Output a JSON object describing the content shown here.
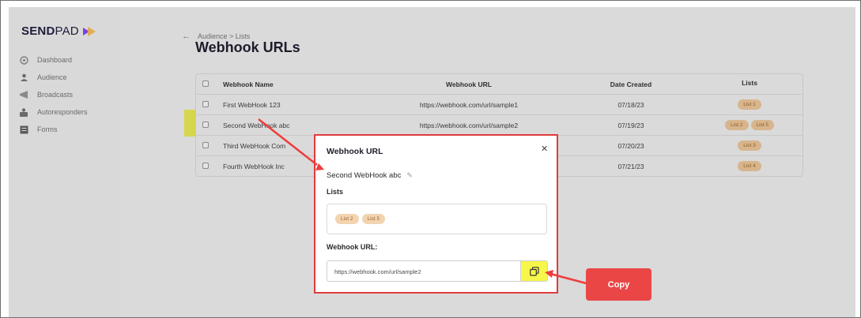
{
  "app": {
    "logo_bold": "SEND",
    "logo_regular": "PAD"
  },
  "sidebar": {
    "items": [
      {
        "label": "Dashboard",
        "icon": "dashboard-icon"
      },
      {
        "label": "Audience",
        "icon": "audience-icon"
      },
      {
        "label": "Broadcasts",
        "icon": "megaphone-icon"
      },
      {
        "label": "Autoresponders",
        "icon": "autoresponder-icon"
      },
      {
        "label": "Forms",
        "icon": "forms-icon"
      }
    ]
  },
  "header": {
    "breadcrumb": "Audience > Lists",
    "title": "Webhook URLs"
  },
  "table": {
    "columns": [
      "Webhook Name",
      "Webhook URL",
      "Date Created",
      "Lists"
    ],
    "rows": [
      {
        "name": "First WebHook 123",
        "url": "https://webhook.com/url/sample1",
        "date": "07/18/23",
        "lists": [
          "List 1"
        ]
      },
      {
        "name": "Second WebHook abc",
        "url": "https://webhook.com/url/sample2",
        "date": "07/19/23",
        "lists": [
          "List 2",
          "List 5"
        ]
      },
      {
        "name": "Third WebHook Com",
        "url": "",
        "date": "07/20/23",
        "lists": [
          "List 3"
        ]
      },
      {
        "name": "Fourth WebHook Inc",
        "url": "",
        "date": "07/21/23",
        "lists": [
          "List 4"
        ]
      }
    ]
  },
  "modal": {
    "title": "Webhook URL",
    "close_icon": "close-icon",
    "hook_name": "Second WebHook abc",
    "lists_label": "Lists",
    "lists": [
      "List 2",
      "List 5"
    ],
    "url_label": "Webhook URL:",
    "url_value": "https://webhook.com/url/sample2",
    "copy_icon": "copy-icon"
  },
  "annotation": {
    "callout_label": "Copy"
  },
  "colors": {
    "accent": "#e23b3b",
    "highlight": "#f7f64a",
    "pill": "#f2d4b0",
    "logo_mark": "#7b3fe4"
  }
}
